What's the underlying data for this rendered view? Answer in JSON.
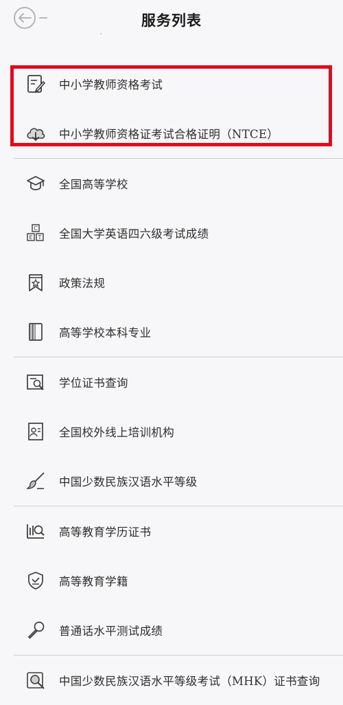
{
  "header": {
    "title": "服务列表"
  },
  "services": [
    {
      "label": "中小学教师资格考试",
      "icon": "document-edit-icon"
    },
    {
      "label": "中小学教师资格证考试合格证明（NTCE）",
      "icon": "cloud-download-icon"
    },
    {
      "label": "全国高等学校",
      "icon": "graduation-cap-icon"
    },
    {
      "label": "全国大学英语四六级考试成绩",
      "icon": "cet-letters-icon"
    },
    {
      "label": "政策法规",
      "icon": "star-bookmark-icon"
    },
    {
      "label": "高等学校本科专业",
      "icon": "book-icon"
    },
    {
      "label": "学位证书查询",
      "icon": "certificate-search-icon"
    },
    {
      "label": "全国校外线上培训机构",
      "icon": "id-card-icon"
    },
    {
      "label": "中国少数民族汉语水平等级",
      "icon": "brush-icon"
    },
    {
      "label": "高等教育学历证书",
      "icon": "chart-search-icon"
    },
    {
      "label": "高等教育学籍",
      "icon": "shield-check-icon"
    },
    {
      "label": "普通话水平测试成绩",
      "icon": "microphone-icon"
    },
    {
      "label": "中国少数民族汉语水平等级考试（MHK）证书查询",
      "icon": "magnifier-badge-icon"
    }
  ],
  "colors": {
    "highlight_border": "#e5081b",
    "icon_stroke": "#3c3c3c",
    "divider": "#c9cdd3"
  }
}
